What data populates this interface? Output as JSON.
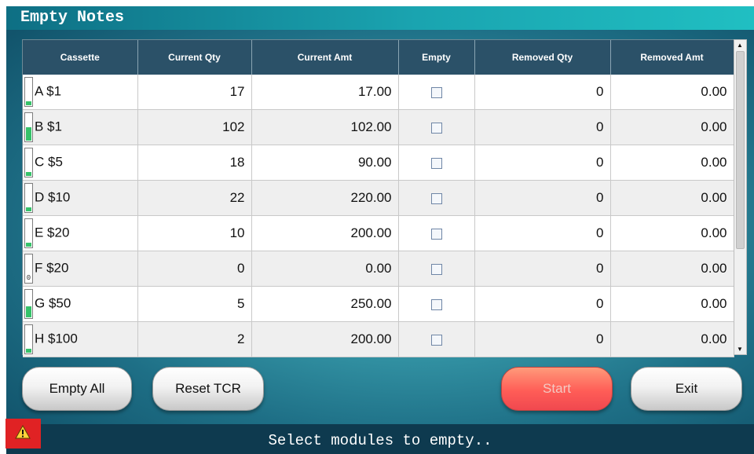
{
  "window": {
    "title": "Empty Notes"
  },
  "table": {
    "headers": [
      "Cassette",
      "Current Qty",
      "Current Amt",
      "Empty",
      "Removed Qty",
      "Removed Amt"
    ],
    "rows": [
      {
        "cassette": "A $1",
        "current_qty": "17",
        "current_amt": "17.00",
        "empty": false,
        "removed_qty": "0",
        "removed_amt": "0.00",
        "level": 0.15,
        "meter": ""
      },
      {
        "cassette": "B $1",
        "current_qty": "102",
        "current_amt": "102.00",
        "empty": false,
        "removed_qty": "0",
        "removed_amt": "0.00",
        "level": 0.5,
        "meter": ""
      },
      {
        "cassette": "C $5",
        "current_qty": "18",
        "current_amt": "90.00",
        "empty": false,
        "removed_qty": "0",
        "removed_amt": "0.00",
        "level": 0.15,
        "meter": ""
      },
      {
        "cassette": "D $10",
        "current_qty": "22",
        "current_amt": "220.00",
        "empty": false,
        "removed_qty": "0",
        "removed_amt": "0.00",
        "level": 0.15,
        "meter": ""
      },
      {
        "cassette": "E $20",
        "current_qty": "10",
        "current_amt": "200.00",
        "empty": false,
        "removed_qty": "0",
        "removed_amt": "0.00",
        "level": 0.15,
        "meter": ""
      },
      {
        "cassette": "F $20",
        "current_qty": "0",
        "current_amt": "0.00",
        "empty": false,
        "removed_qty": "0",
        "removed_amt": "0.00",
        "level": 0,
        "meter": "0"
      },
      {
        "cassette": "G $50",
        "current_qty": "5",
        "current_amt": "250.00",
        "empty": false,
        "removed_qty": "0",
        "removed_amt": "0.00",
        "level": 0.4,
        "meter": ""
      },
      {
        "cassette": "H $100",
        "current_qty": "2",
        "current_amt": "200.00",
        "empty": false,
        "removed_qty": "0",
        "removed_amt": "0.00",
        "level": 0.15,
        "meter": ""
      }
    ]
  },
  "buttons": {
    "empty_all": "Empty All",
    "reset_tcr": "Reset TCR",
    "start": "Start",
    "exit": "Exit"
  },
  "status": {
    "message": "Select modules to empty..",
    "icon": "warning-icon"
  },
  "colors": {
    "header_bg": "#2b5168",
    "start_button": "#ff5d57",
    "warning_bg": "#e02224",
    "meter_fill": "#36c26a"
  }
}
